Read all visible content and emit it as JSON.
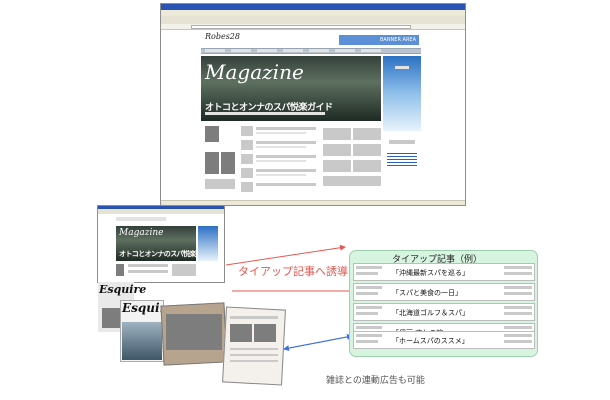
{
  "site": {
    "logo": "Robes28",
    "banner_area": "BANNER AREA",
    "hero": {
      "title": "Magazine",
      "headline": "オトコとオンナのスパ悦楽ガイド"
    }
  },
  "diagram": {
    "arrow_label": "タイアップ記事へ誘導",
    "caption": "雑誌との連動広告も可能",
    "magazine_brand": "Esquire"
  },
  "tieup": {
    "title": "タイアップ記事（例）",
    "rows": [
      {
        "article": "「沖縄最新スパを巡る」"
      },
      {
        "article": "「スパと美食の一日」"
      },
      {
        "article": "「北海道ゴルフ＆スパ」"
      },
      {
        "article": "「伊豆 癒しの旅」"
      },
      {
        "article": "「ホームスパのススメ」"
      }
    ]
  },
  "colors": {
    "arrow_red": "#e8574f",
    "arrow_blue": "#3d6fe0",
    "tieup_bg": "#d7f4e1",
    "title_bar": "#2b53b3"
  }
}
